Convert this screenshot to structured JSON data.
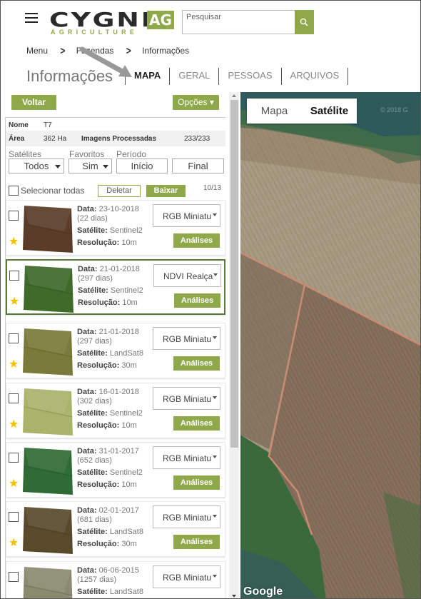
{
  "header": {
    "logo_main": "CYGNI",
    "logo_ag": "AG",
    "logo_sub": "AGRICULTURE",
    "search_placeholder": "Pesquisar",
    "brand_color": "#8fa84a"
  },
  "breadcrumb": [
    "Menu",
    "Fazendas",
    "Informações"
  ],
  "page": {
    "title": "Informações",
    "tabs": [
      {
        "label": "MAPA",
        "active": true
      },
      {
        "label": "GERAL",
        "active": false
      },
      {
        "label": "PESSOAS",
        "active": false
      },
      {
        "label": "ARQUIVOS",
        "active": false
      }
    ]
  },
  "actions": {
    "back": "Voltar",
    "options": "Opções ▾"
  },
  "field_info": {
    "name_label": "Nome",
    "name_value": "T7",
    "area_label": "Área",
    "area_value": "362 Ha",
    "images_label": "Imagens Processadas",
    "images_value": "233/233"
  },
  "filters": {
    "satellites_label": "Satélites",
    "satellites_value": "Todos",
    "favorites_label": "Favoritos",
    "favorites_value": "Sim",
    "period_label": "Período",
    "period_start": "Início",
    "period_end": "Final"
  },
  "list_controls": {
    "select_all": "Selecionar todas",
    "delete": "Deletar",
    "download": "Baixar",
    "counter": "10/13"
  },
  "cards": [
    {
      "date": "23-10-2018",
      "days": "(22 dias)",
      "satellite": "Sentinel2",
      "resolution": "10m",
      "visualization": "RGB Miniatu",
      "favorite": true,
      "selected": false,
      "thumb_color": "#5a3c28"
    },
    {
      "date": "21-01-2018",
      "days": "(297 dias)",
      "satellite": "Sentinel2",
      "resolution": "10m",
      "visualization": "NDVI Realça",
      "favorite": true,
      "selected": true,
      "thumb_color": "#3e6a2a"
    },
    {
      "date": "21-01-2018",
      "days": "(297 dias)",
      "satellite": "LandSat8",
      "resolution": "30m",
      "visualization": "RGB Miniatu",
      "favorite": true,
      "selected": false,
      "thumb_color": "#7a7a3a"
    },
    {
      "date": "16-01-2018",
      "days": "(302 dias)",
      "satellite": "Sentinel2",
      "resolution": "10m",
      "visualization": "RGB Miniatu",
      "favorite": true,
      "selected": false,
      "thumb_color": "#a9b36a"
    },
    {
      "date": "31-01-2017",
      "days": "(652 dias)",
      "satellite": "Sentinel2",
      "resolution": "10m",
      "visualization": "RGB Miniatu",
      "favorite": true,
      "selected": false,
      "thumb_color": "#2f6b35"
    },
    {
      "date": "02-01-2017",
      "days": "(681 dias)",
      "satellite": "LandSat8",
      "resolution": "30m",
      "visualization": "RGB Miniatu",
      "favorite": true,
      "selected": false,
      "thumb_color": "#5a4a2c"
    },
    {
      "date": "06-06-2015",
      "days": "(1257 dias)",
      "satellite": "LandSat8",
      "resolution": "",
      "visualization": "RGB Miniatu",
      "favorite": true,
      "selected": false,
      "thumb_color": "#8a8a70"
    }
  ],
  "labels": {
    "date": "Data:",
    "satellite": "Satélite:",
    "resolution": "Resolução:",
    "analyses": "Análises"
  },
  "map": {
    "toggle_map": "Mapa",
    "toggle_satellite": "Satélite",
    "active_view": "Satélite",
    "attribution": "Google",
    "copyright": "© 2018 G"
  }
}
